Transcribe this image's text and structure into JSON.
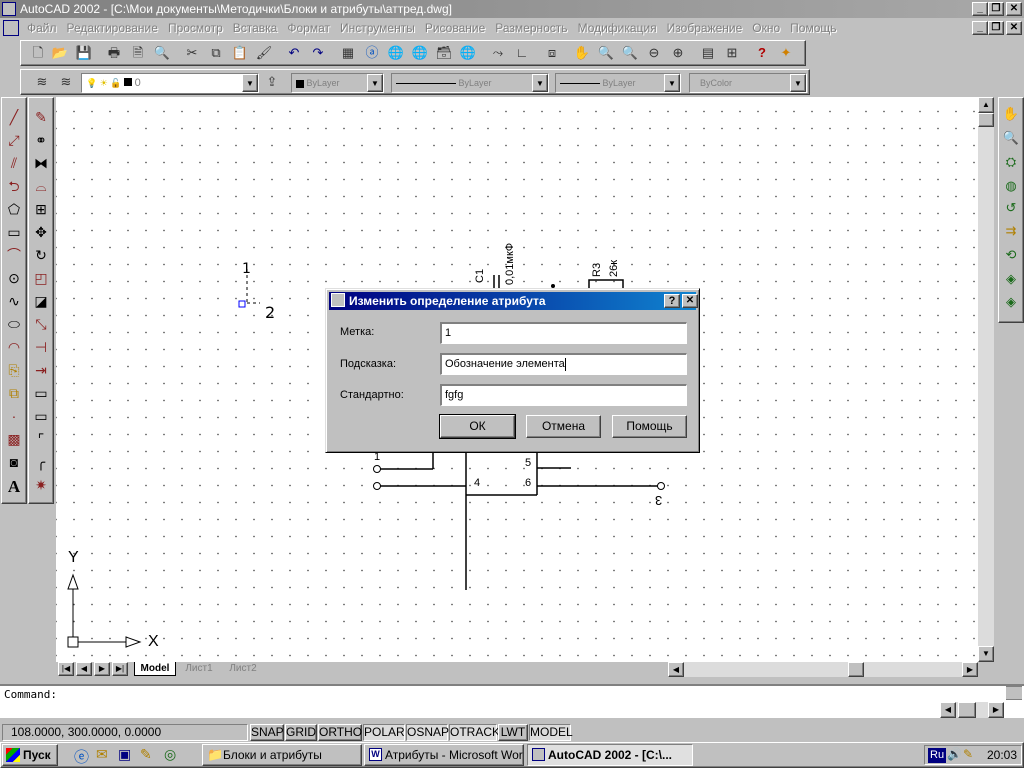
{
  "window": {
    "title": "AutoCAD 2002 - [C:\\Мои документы\\Методички\\Блоки и атрибуты\\аттред.dwg]"
  },
  "menu": [
    "Файл",
    "Редактирование",
    "Просмотр",
    "Вставка",
    "Формат",
    "Инструменты",
    "Рисование",
    "Размерность",
    "Модификация",
    "Изображение",
    "Окно",
    "Помощь"
  ],
  "properties": {
    "layer": "0",
    "color": "ByLayer",
    "linetype": "ByLayer",
    "lineweight": "ByLayer",
    "plotstyle": "ByColor"
  },
  "drawing": {
    "label_1": "1",
    "label_2": "2",
    "c1_ref": "C1",
    "c1_value": "0,01мкФ",
    "r3_ref": "R3",
    "r3_value": "26к",
    "pin_1": "1",
    "pin_5": "5",
    "pin_4": "4",
    "pin_6": "6",
    "label_3": "3",
    "ucs_y": "Y",
    "ucs_x": "X"
  },
  "tabs": [
    "Model",
    "Лист1",
    "Лист2"
  ],
  "command": {
    "prompt": "Command:"
  },
  "status": {
    "coords": "108.0000, 300.0000, 0.0000",
    "modes": [
      "SNAP",
      "GRID",
      "ORTHO",
      "POLAR",
      "OSNAP",
      "OTRACK",
      "LWT",
      "MODEL"
    ]
  },
  "dialog": {
    "title": "Изменить определение атрибута",
    "tag_label": "Метка:",
    "tag_value": "1",
    "prompt_label": "Подсказка:",
    "prompt_value": "Обозначение элемента",
    "default_label": "Стандартно:",
    "default_value": "fgfg",
    "ok": "ОК",
    "cancel": "Отмена",
    "help": "Помощь",
    "help_icon": "?",
    "close_icon": "✕"
  },
  "taskbar": {
    "start": "Пуск",
    "tasks": [
      "Блоки и атрибуты",
      "Атрибуты - Microsoft Word",
      "AutoCAD 2002 - [C:\\..."
    ],
    "lang": "Ru",
    "clock": "20:03"
  }
}
